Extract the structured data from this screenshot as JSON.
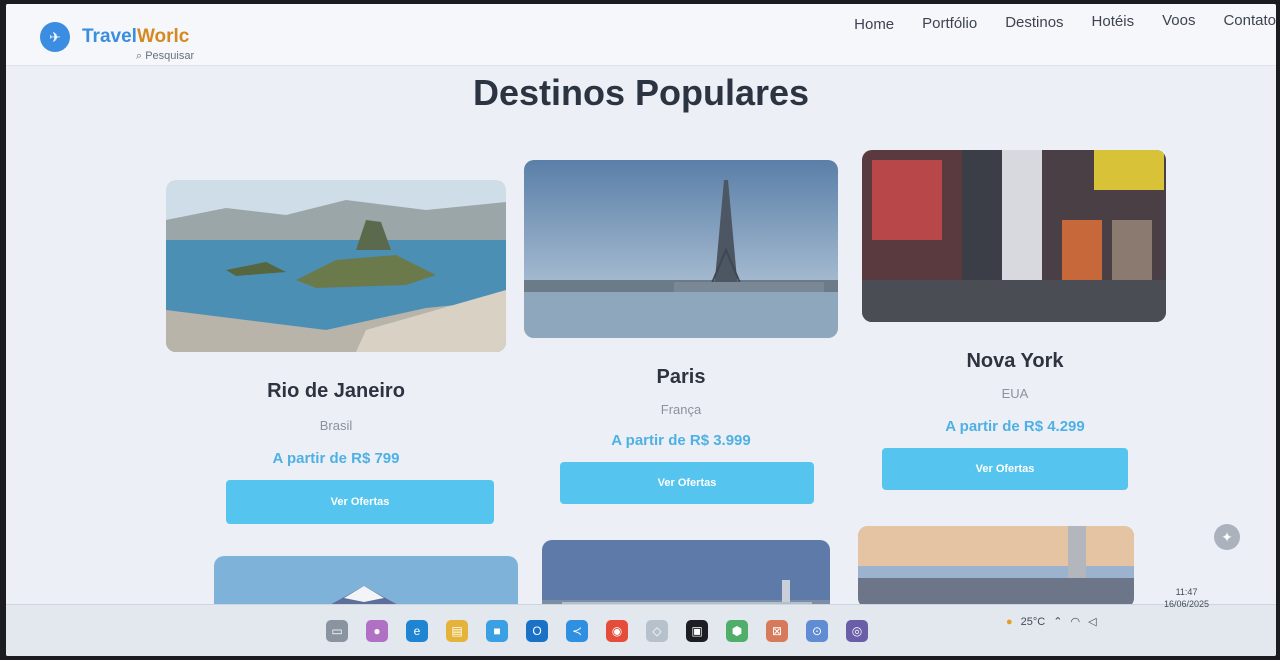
{
  "header": {
    "logo_part1": "Travel",
    "logo_part2": "Worlc",
    "nav": [
      "Home",
      "Portfólio",
      "Destinos",
      "Hotéis",
      "Voos",
      "Contato"
    ]
  },
  "page_title": "Destinos Populares",
  "cards": [
    {
      "city": "Rio de Janeiro",
      "country": "Brasil",
      "price": "A partir de R$ 799",
      "button": "Ver Ofertas"
    },
    {
      "city": "Paris",
      "country": "França",
      "price": "A partir de R$ 3.999",
      "button": "Ver Ofertas"
    },
    {
      "city": "Nova York",
      "country": "EUA",
      "price": "A partir de R$ 4.299",
      "button": "Ver Ofertas"
    }
  ],
  "taskbar": {
    "search_placeholder": "Pesquisar",
    "temperature": "25°C",
    "time": "11:47",
    "date": "16/06/2025"
  },
  "colors": {
    "accent": "#55c4ee",
    "price": "#4fb0e3",
    "logo_blue": "#3a8de0",
    "logo_orange": "#d48a20"
  }
}
